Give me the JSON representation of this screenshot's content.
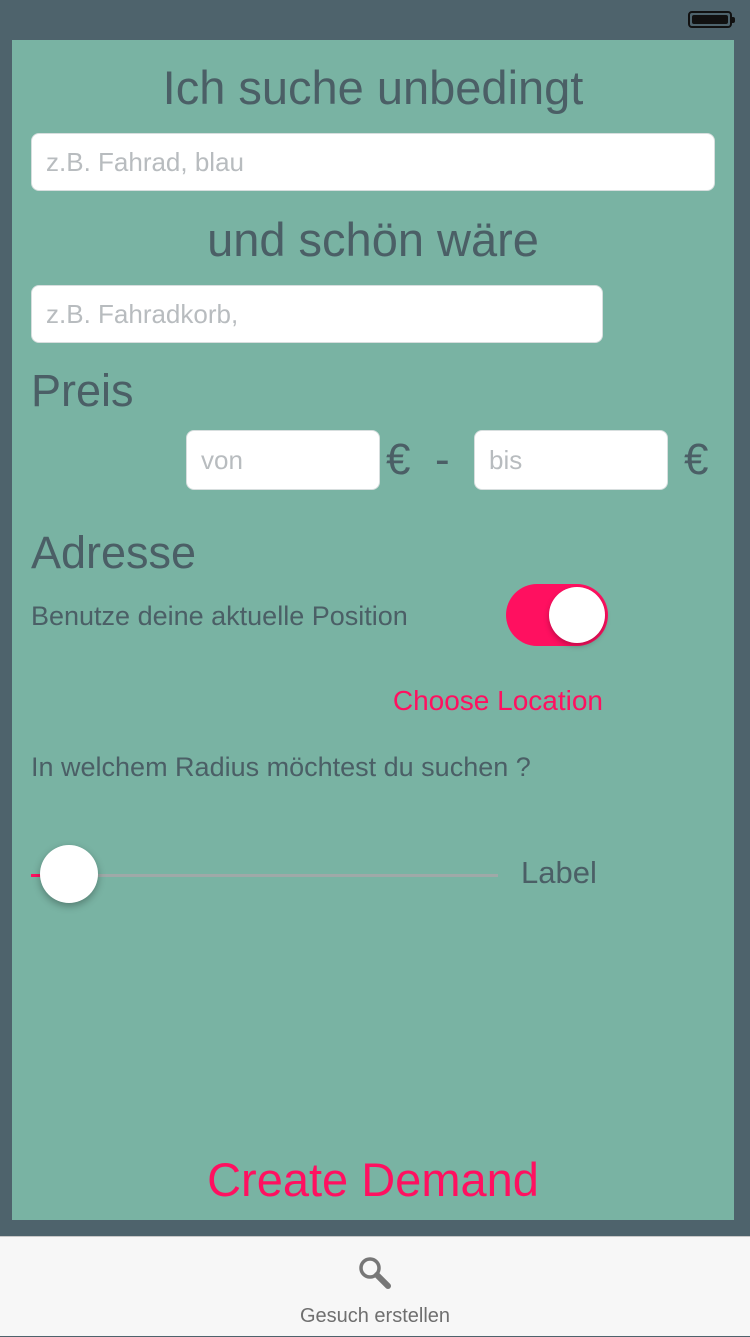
{
  "form": {
    "must_have_heading": "Ich suche unbedingt",
    "must_have_placeholder": "z.B. Fahrad, blau",
    "nice_to_have_heading": "und schön wäre",
    "nice_to_have_placeholder": "z.B. Fahradkorb,",
    "price": {
      "title": "Preis",
      "from_placeholder": "von",
      "to_placeholder": "bis",
      "currency": "€",
      "separator": "-"
    },
    "address": {
      "title": "Adresse",
      "use_location_label": "Benutze deine aktuelle Position",
      "use_location_enabled": true,
      "choose_location_label": "Choose Location"
    },
    "radius": {
      "question": "In welchem Radius möchtest du suchen ?",
      "slider_value_fraction": 0.06,
      "value_label": "Label"
    },
    "submit_label": "Create Demand"
  },
  "tab_bar": {
    "items": [
      {
        "label": "Gesuch erstellen",
        "icon": "search-icon"
      }
    ]
  },
  "colors": {
    "background": "#79b3a3",
    "frame": "#4e636c",
    "text": "#4b5f66",
    "accent": "#ff1060"
  }
}
